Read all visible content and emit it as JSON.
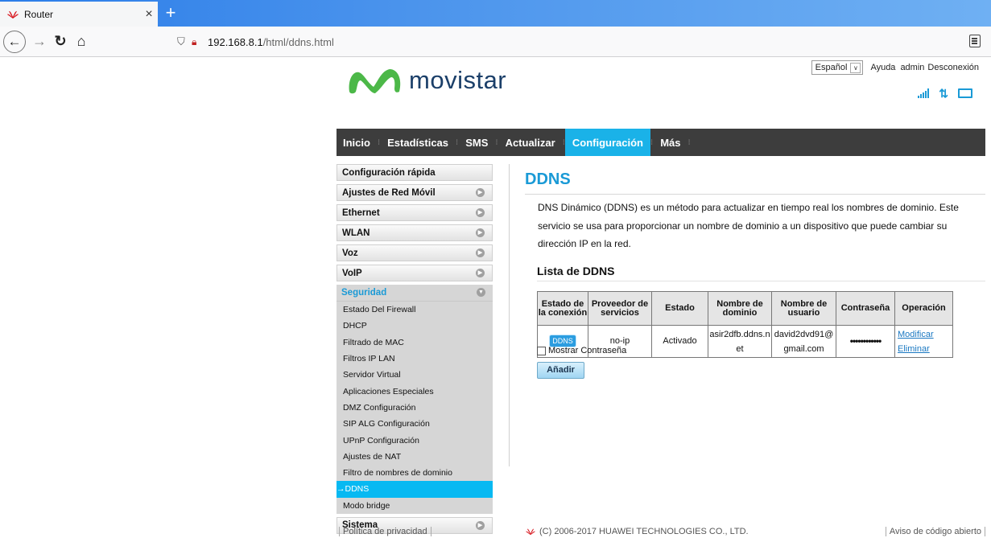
{
  "browser": {
    "tab_title": "Router",
    "tab_close": "×",
    "new_tab": "+",
    "url_host": "192.168.8.1",
    "url_path": "/html/ddns.html",
    "back_glyph": "←",
    "forward_glyph": "→",
    "reload_glyph": "↻",
    "home_glyph": "⌂"
  },
  "header": {
    "brand": "movistar",
    "language": "Español",
    "links": [
      "Ayuda",
      "admin",
      "Desconexión"
    ]
  },
  "nav": {
    "items": [
      "Inicio",
      "Estadísticas",
      "SMS",
      "Actualizar",
      "Configuración",
      "Más"
    ],
    "active": "Configuración"
  },
  "sidebar": {
    "groups_top": [
      "Configuración rápida",
      "Ajustes de Red Móvil",
      "Ethernet",
      "WLAN",
      "Voz",
      "VoIP"
    ],
    "open_group": "Seguridad",
    "sub_items": [
      "Estado Del Firewall",
      "DHCP",
      "Filtrado de MAC",
      "Filtros IP LAN",
      "Servidor Virtual",
      "Aplicaciones Especiales",
      "DMZ Configuración",
      "SIP ALG Configuración",
      "UPnP Configuración",
      "Ajustes de NAT",
      "Filtro de nombres de dominio",
      "→DDNS",
      "Modo bridge"
    ],
    "active_sub": "→DDNS",
    "groups_bottom": [
      "Sistema"
    ]
  },
  "content": {
    "title": "DDNS",
    "description": "DNS Dinámico (DDNS) es un método para actualizar en tiempo real los nombres de dominio. Este servicio se usa para proporcionar un nombre de dominio a un dispositivo que puede cambiar su dirección IP en la red.",
    "list_title": "Lista de DDNS",
    "table": {
      "headers": [
        "Estado de la conexión",
        "Proveedor de servicios",
        "Estado",
        "Nombre de dominio",
        "Nombre de usuario",
        "Contraseña",
        "Operación"
      ],
      "rows": [
        {
          "status_chip": "DDNS",
          "provider": "no-ip",
          "state": "Activado",
          "domain": "asir2dfb.ddns.net",
          "username": "david2dvd91@gmail.com",
          "password": "••••••••••••",
          "edit": "Modificar",
          "delete": "Eliminar"
        }
      ]
    },
    "show_password_label": "Mostrar Contraseña",
    "add_button": "Añadir"
  },
  "footer": {
    "privacy": "Política de privacidad",
    "copyright": "(C) 2006-2017 HUAWEI TECHNOLOGIES CO., LTD.",
    "open_source": "Aviso de código abierto"
  },
  "colors": {
    "accent": "#1ab2e8",
    "nav_bg": "#3d3d3d",
    "brand_text": "#1b3f69",
    "active_sub": "#07b9f2"
  }
}
